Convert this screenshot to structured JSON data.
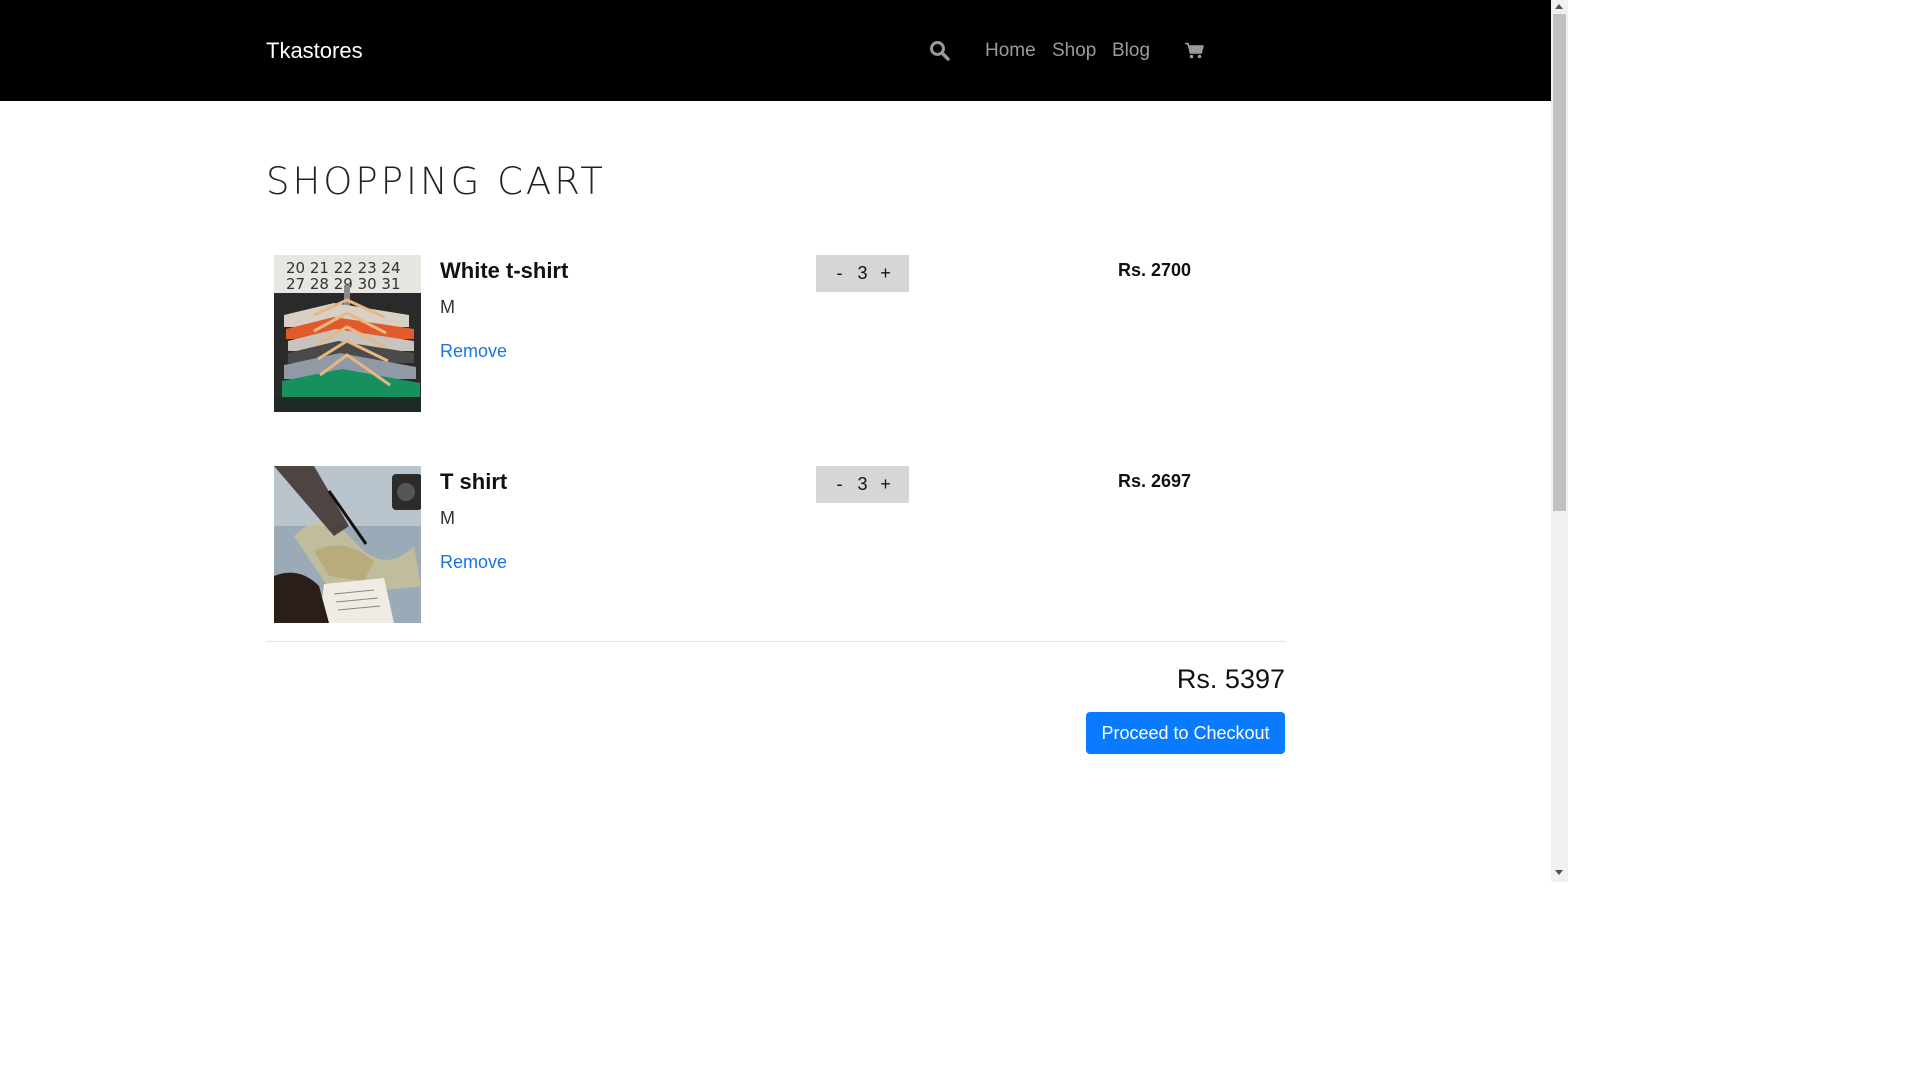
{
  "navbar": {
    "brand": "Tkastores",
    "links": [
      "Home",
      "Shop",
      "Blog"
    ],
    "icons": [
      "search-icon",
      "cart-icon"
    ],
    "background": "#000000"
  },
  "page": {
    "title": "SHOPPING CART"
  },
  "items": [
    {
      "name": "White t-shirt",
      "size": "M",
      "remove_label": "Remove",
      "qty_minus": "-",
      "qty": "3",
      "qty_plus": "+",
      "price": "Rs. 2700",
      "image": "clothes-on-hangers-photo"
    },
    {
      "name": "T shirt",
      "size": "M",
      "remove_label": "Remove",
      "qty_minus": "-",
      "qty": "3",
      "qty_plus": "+",
      "price": "Rs. 2697",
      "image": "map-and-notebook-photo"
    }
  ],
  "summary": {
    "total": "Rs. 5397",
    "checkout_label": "Proceed to Checkout",
    "accent": "#0a7bff"
  }
}
